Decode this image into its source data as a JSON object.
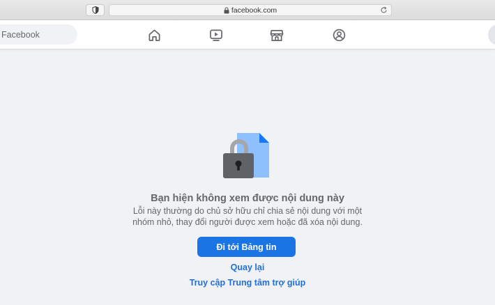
{
  "browser": {
    "url": "facebook.com"
  },
  "header": {
    "search_placeholder": "Facebook",
    "nav_icons": [
      "home-icon",
      "video-icon",
      "marketplace-icon",
      "groups-icon"
    ]
  },
  "content": {
    "title": "Bạn hiện không xem được nội dung này",
    "description_line1": "Lỗi này thường do chủ sở hữu chỉ chia sẻ nội dung với một",
    "description_line2": "nhóm nhỏ, thay đổi người được xem hoặc đã xóa nội dung.",
    "primary_button": "Đi tới Bảng tin",
    "back_link": "Quay lại",
    "help_link": "Truy cập Trung tâm trợ giúp"
  },
  "colors": {
    "primary": "#1b74e4",
    "link": "#216fdb",
    "background": "#f0f2f5",
    "text_secondary": "#65676b"
  }
}
